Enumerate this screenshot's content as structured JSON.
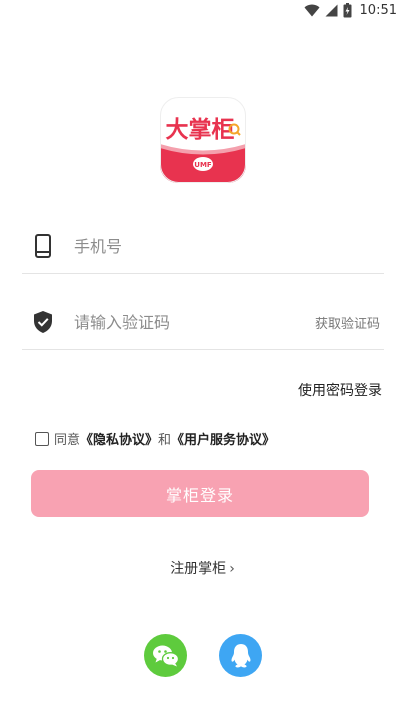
{
  "status_bar": {
    "time": "10:51"
  },
  "logo": {
    "brand_text": "大掌柜",
    "badge_text": "UMF"
  },
  "phone_field": {
    "placeholder": "手机号",
    "value": ""
  },
  "code_field": {
    "placeholder": "请输入验证码",
    "value": "",
    "get_code_label": "获取验证码"
  },
  "password_login_label": "使用密码登录",
  "agreement": {
    "checked": false,
    "prefix": "同意",
    "privacy": "《隐私协议》",
    "and": "和",
    "service": "《用户服务协议》"
  },
  "login_button_label": "掌柜登录",
  "register_label": "注册掌柜",
  "register_arrow": "›",
  "social": [
    {
      "name": "wechat-icon",
      "color": "#5ecb3d"
    },
    {
      "name": "qq-icon",
      "color": "#3ea6f3"
    }
  ],
  "colors": {
    "accent": "#e8334f",
    "button_disabled": "#f8a2b2"
  }
}
